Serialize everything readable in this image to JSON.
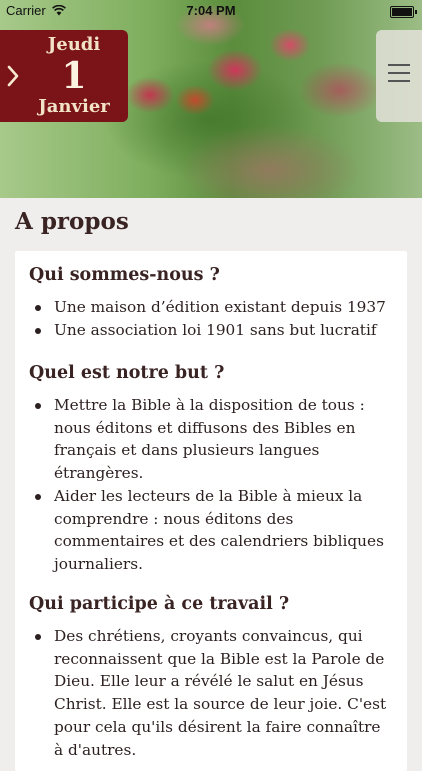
{
  "status_bar": {
    "carrier": "Carrier",
    "time": "7:04 PM"
  },
  "date": {
    "day_name": "Jeudi",
    "day_number": "1",
    "month": "Janvier"
  },
  "page_title": "A propos",
  "sections": [
    {
      "heading": "Qui sommes-nous ?",
      "items": [
        "Une maison d’édition existant depuis 1937",
        "Une association loi 1901 sans but lucratif"
      ]
    },
    {
      "heading": "Quel est notre but ?",
      "items": [
        "Mettre la Bible à la disposition de tous : nous éditons et diffusons des Bibles en français et dans plusieurs langues étrangères.",
        "Aider les lecteurs de la Bible à mieux la comprendre : nous éditons des commentaires et des calendriers bibliques journaliers."
      ]
    },
    {
      "heading": "Qui participe à  ce travail ?",
      "items": [
        "Des chrétiens, croyants convaincus, qui reconnaissent que la Bible est la Parole de Dieu. Elle leur a révélé le salut en Jésus Christ. Elle est la source de leur joie. C'est pour cela qu'ils désirent la faire connaître à d'autres."
      ]
    }
  ],
  "icons": {
    "wifi": "wifi-icon",
    "battery": "battery-icon",
    "arrow": "chevron-right-icon",
    "menu": "hamburger-menu-icon"
  },
  "colors": {
    "date_box": "#7b1418",
    "date_text": "#f3e3c6",
    "background": "#efeeec",
    "card": "#ffffff"
  }
}
